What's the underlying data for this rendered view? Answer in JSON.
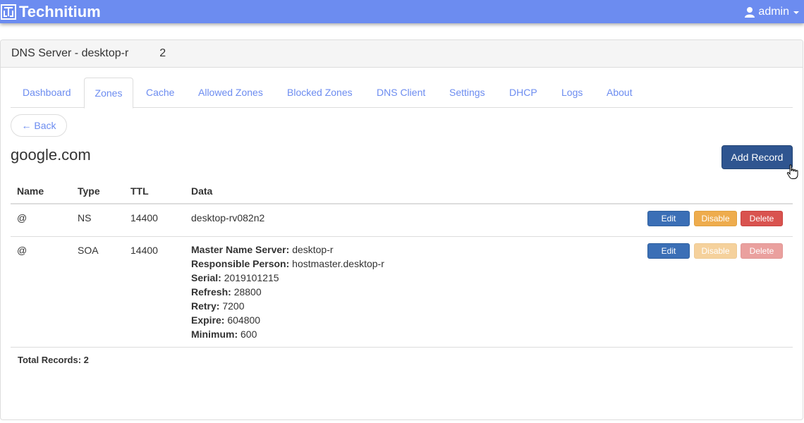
{
  "navbar": {
    "brand": "Technitium",
    "user": "admin",
    "colors": {
      "navbar": "#6c8cf0",
      "primary": "#2f5590",
      "edit": "#3b6fb6",
      "disable": "#eeac4d",
      "delete": "#d9534f"
    }
  },
  "panel": {
    "title": "DNS Server - desktop-r",
    "title_suffix": "2"
  },
  "tabs": [
    "Dashboard",
    "Zones",
    "Cache",
    "Allowed Zones",
    "Blocked Zones",
    "DNS Client",
    "Settings",
    "DHCP",
    "Logs",
    "About"
  ],
  "active_tab": "Zones",
  "back_label": "← Back",
  "zone": {
    "name": "google.com",
    "add_record_label": "Add Record"
  },
  "table": {
    "headers": {
      "name": "Name",
      "type": "Type",
      "ttl": "TTL",
      "data": "Data"
    },
    "rows": [
      {
        "name": "@",
        "type": "NS",
        "ttl": "14400",
        "data": "desktop-rv082n2",
        "actions": {
          "edit": "Edit",
          "disable": "Disable",
          "delete": "Delete"
        }
      },
      {
        "name": "@",
        "type": "SOA",
        "ttl": "14400",
        "soa": [
          {
            "label": "Master Name Server:",
            "value": "desktop-r"
          },
          {
            "label": "Responsible Person:",
            "value": "hostmaster.desktop-r"
          },
          {
            "label": "Serial:",
            "value": "2019101215"
          },
          {
            "label": "Refresh:",
            "value": "28800"
          },
          {
            "label": "Retry:",
            "value": "7200"
          },
          {
            "label": "Expire:",
            "value": "604800"
          },
          {
            "label": "Minimum:",
            "value": "600"
          }
        ],
        "actions": {
          "edit": "Edit",
          "disable": "Disable",
          "delete": "Delete"
        }
      }
    ],
    "total": "Total Records: 2"
  }
}
